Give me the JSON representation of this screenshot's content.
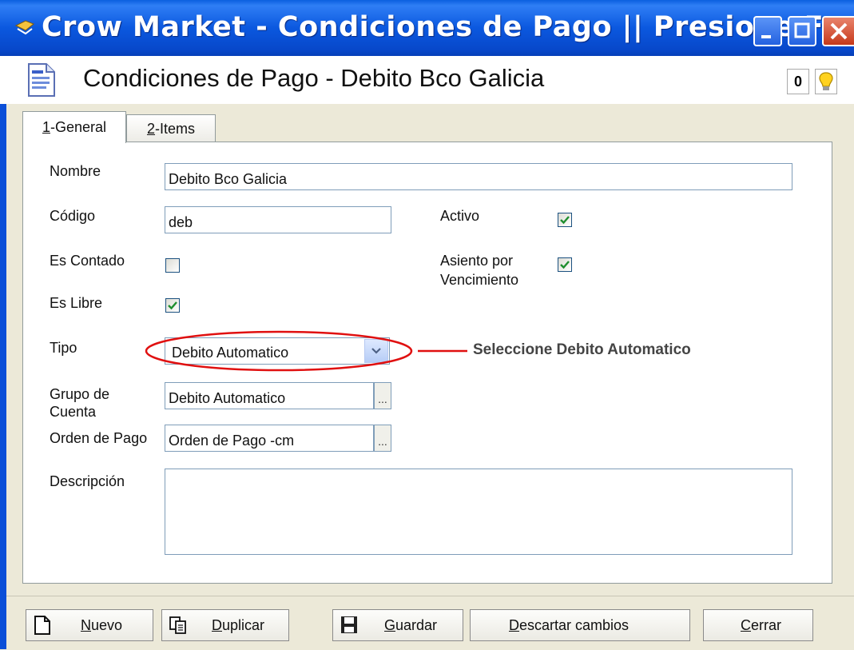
{
  "window": {
    "title": "Crow Market - Condiciones de Pago || Presione F...",
    "minimize_glyph": "_",
    "maximize_glyph": "□",
    "close_glyph": "✕"
  },
  "header": {
    "heading": "Condiciones de Pago - Debito Bco Galicia",
    "attach_glyph": "0"
  },
  "tabs": [
    {
      "key": "1",
      "label": "-General"
    },
    {
      "key": "2",
      "label": "-Items"
    }
  ],
  "form": {
    "nombre_label": "Nombre",
    "nombre_value": "Debito Bco Galicia",
    "codigo_label": "Código",
    "codigo_value": "deb",
    "activo_label": "Activo",
    "activo_checked": true,
    "es_contado_label": "Es Contado",
    "es_contado_checked": false,
    "asiento_label_1": "Asiento por",
    "asiento_label_2": "Vencimiento",
    "asiento_checked": true,
    "es_libre_label": "Es Libre",
    "es_libre_checked": true,
    "tipo_label": "Tipo",
    "tipo_value": "Debito Automatico",
    "grupo_label_1": "Grupo de",
    "grupo_label_2": "Cuenta",
    "grupo_value": "Debito Automatico",
    "orden_label": "Orden de Pago",
    "orden_value": "Orden de Pago -cm",
    "descripcion_label": "Descripción",
    "descripcion_value": "",
    "ellipsis": "..."
  },
  "annotation": {
    "text": "Seleccione Debito Automatico",
    "color": "#e01010"
  },
  "toolbar": {
    "nuevo": "Nuevo",
    "duplicar": "Duplicar",
    "guardar": "Guardar",
    "descartar": "Descartar cambios",
    "cerrar": "Cerrar"
  },
  "colors": {
    "titlebar": "#0b58df",
    "check": "#1e8e2e",
    "field_border": "#7f9db9"
  }
}
